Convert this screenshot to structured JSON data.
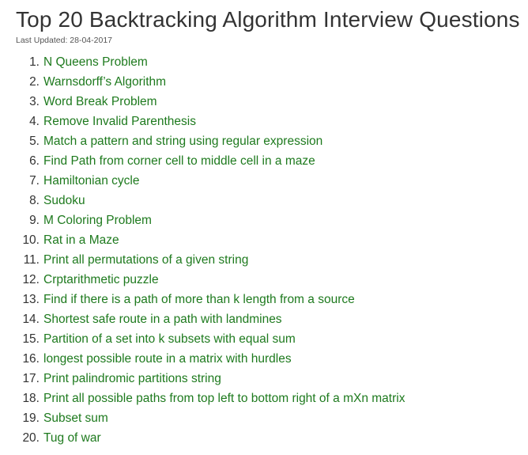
{
  "article": {
    "title": "Top 20 Backtracking Algorithm Interview Questions",
    "last_updated": "Last Updated: 28-04-2017",
    "link_color": "#1e7a1e",
    "questions": [
      {
        "number": "1.",
        "label": "N Queens Problem"
      },
      {
        "number": "2.",
        "label": "Warnsdorff’s Algorithm"
      },
      {
        "number": "3.",
        "label": "Word Break Problem"
      },
      {
        "number": "4.",
        "label": "Remove Invalid Parenthesis"
      },
      {
        "number": "5.",
        "label": "Match a pattern and string using regular expression"
      },
      {
        "number": "6.",
        "label": "Find Path from corner cell to middle cell in a maze"
      },
      {
        "number": "7.",
        "label": "Hamiltonian cycle"
      },
      {
        "number": "8.",
        "label": "Sudoku"
      },
      {
        "number": "9.",
        "label": "M Coloring Problem"
      },
      {
        "number": "10.",
        "label": "Rat in a Maze"
      },
      {
        "number": "11.",
        "label": "Print all permutations of a given string"
      },
      {
        "number": "12.",
        "label": "Crptarithmetic puzzle"
      },
      {
        "number": "13.",
        "label": "Find if there is a path of more than k length from a source"
      },
      {
        "number": "14.",
        "label": "Shortest safe route in a path with landmines"
      },
      {
        "number": "15.",
        "label": "Partition of a set into k subsets with equal sum"
      },
      {
        "number": "16.",
        "label": "longest possible route in a matrix with hurdles"
      },
      {
        "number": "17.",
        "label": "Print palindromic partitions string"
      },
      {
        "number": "18.",
        "label": "Print all possible paths from top left to bottom right of a mXn matrix"
      },
      {
        "number": "19.",
        "label": "Subset sum"
      },
      {
        "number": "20.",
        "label": "Tug of war"
      }
    ]
  }
}
